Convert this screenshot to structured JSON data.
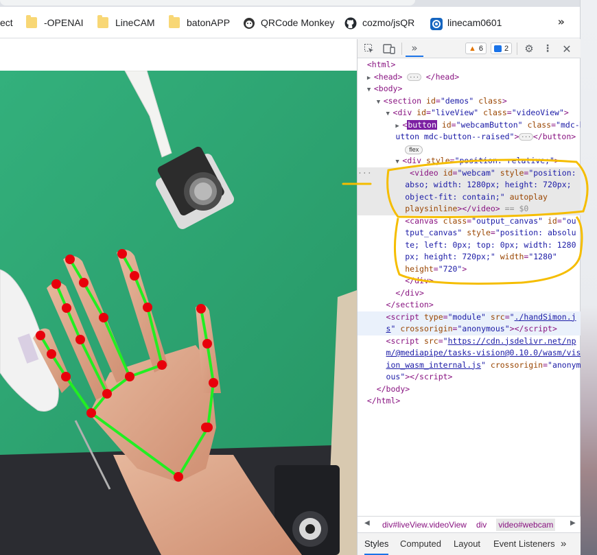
{
  "bookmarks": [
    {
      "label": "ect",
      "icon": "none"
    },
    {
      "label": "-OPENAI",
      "icon": "folder-icon"
    },
    {
      "label": "LineCAM",
      "icon": "folder-icon"
    },
    {
      "label": "batonAPP",
      "icon": "folder-icon"
    },
    {
      "label": "QRCode Monkey",
      "icon": "monkey-icon"
    },
    {
      "label": "cozmo/jsQR",
      "icon": "github-icon"
    },
    {
      "label": "linecam0601",
      "icon": "linecam-icon"
    }
  ],
  "bookmarks_overflow": "»",
  "devtools": {
    "warnings_count": "6",
    "messages_count": "2",
    "breadcrumbs": [
      "div#liveView.videoView",
      "div",
      "video#webcam"
    ],
    "tabs": [
      "Styles",
      "Computed",
      "Layout",
      "Event Listeners"
    ],
    "tabs_overflow": "»",
    "dollar_zero": "== $0"
  },
  "colors": {
    "landmark": "#e8000b",
    "connector": "#22ee22",
    "annotation": "#f5bd00",
    "board": "#2ea874"
  }
}
